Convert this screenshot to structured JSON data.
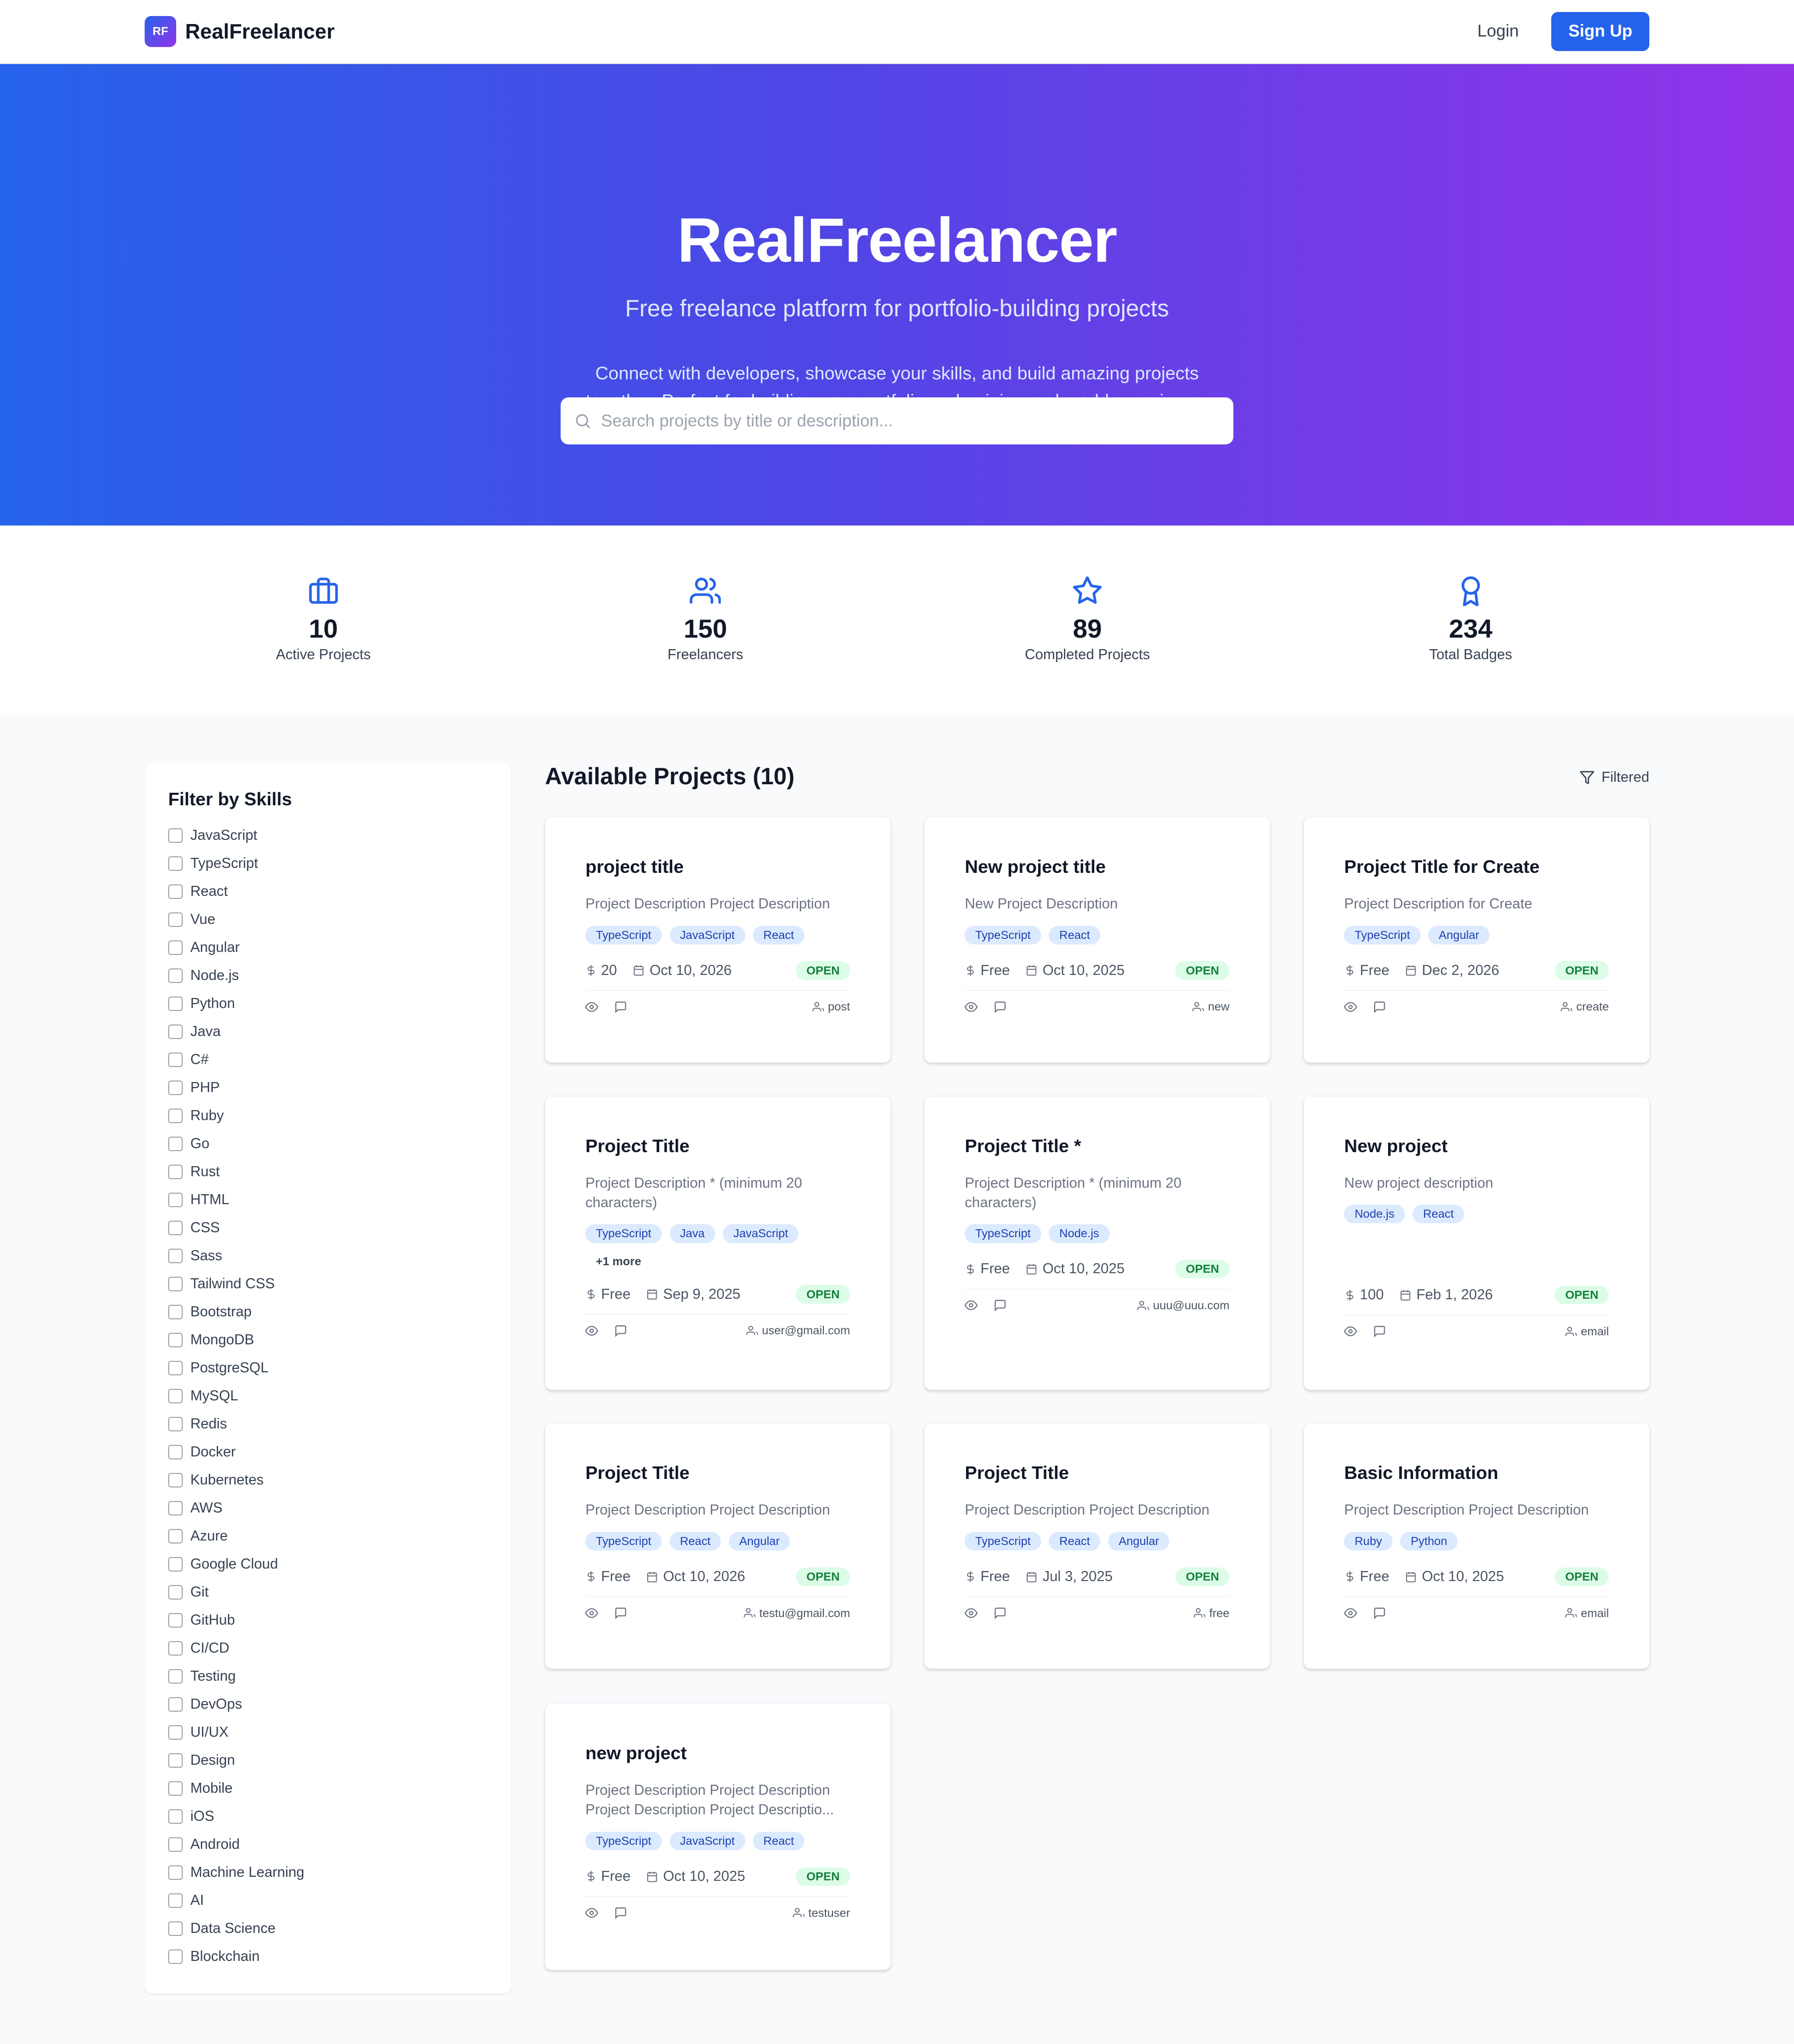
{
  "header": {
    "logo_mark": "RF",
    "brand": "RealFreelancer",
    "login": "Login",
    "signup": "Sign Up"
  },
  "hero": {
    "title": "RealFreelancer",
    "tagline": "Free freelance platform for portfolio-building projects",
    "description": "Connect with developers, showcase your skills, and build amazing projects together. Perfect for building your portfolio and gaining real-world experience.",
    "search_placeholder": "Search projects by title or description..."
  },
  "stats": [
    {
      "value": "10",
      "label": "Active Projects",
      "icon": "briefcase-icon"
    },
    {
      "value": "150",
      "label": "Freelancers",
      "icon": "users-icon"
    },
    {
      "value": "89",
      "label": "Completed Projects",
      "icon": "star-icon"
    },
    {
      "value": "234",
      "label": "Total Badges",
      "icon": "award-icon"
    }
  ],
  "sidebar": {
    "title": "Filter by Skills",
    "skills": [
      "JavaScript",
      "TypeScript",
      "React",
      "Vue",
      "Angular",
      "Node.js",
      "Python",
      "Java",
      "C#",
      "PHP",
      "Ruby",
      "Go",
      "Rust",
      "HTML",
      "CSS",
      "Sass",
      "Tailwind CSS",
      "Bootstrap",
      "MongoDB",
      "PostgreSQL",
      "MySQL",
      "Redis",
      "Docker",
      "Kubernetes",
      "AWS",
      "Azure",
      "Google Cloud",
      "Git",
      "GitHub",
      "CI/CD",
      "Testing",
      "DevOps",
      "UI/UX",
      "Design",
      "Mobile",
      "iOS",
      "Android",
      "Machine Learning",
      "AI",
      "Data Science",
      "Blockchain"
    ]
  },
  "projects_heading": "Available Projects (10)",
  "filtered_label": "Filtered",
  "projects": [
    {
      "title": "project title",
      "description": "Project Description Project Description",
      "tags": [
        "TypeScript",
        "JavaScript",
        "React"
      ],
      "more": "",
      "price": "20",
      "date": "Oct 10, 2026",
      "status": "OPEN",
      "owner": "post"
    },
    {
      "title": "New project title",
      "description": "New Project Description",
      "tags": [
        "TypeScript",
        "React"
      ],
      "more": "",
      "price": "Free",
      "date": "Oct 10, 2025",
      "status": "OPEN",
      "owner": "new"
    },
    {
      "title": "Project Title for Create",
      "description": "Project Description for Create",
      "tags": [
        "TypeScript",
        "Angular"
      ],
      "more": "",
      "price": "Free",
      "date": "Dec 2, 2026",
      "status": "OPEN",
      "owner": "create"
    },
    {
      "title": "Project Title",
      "description": "Project Description * (minimum 20 characters)",
      "tags": [
        "TypeScript",
        "Java",
        "JavaScript"
      ],
      "more": "+1 more",
      "price": "Free",
      "date": "Sep 9, 2025",
      "status": "OPEN",
      "owner": "user@gmail.com"
    },
    {
      "title": "Project Title *",
      "description": "Project Description * (minimum 20 characters)",
      "tags": [
        "TypeScript",
        "Node.js"
      ],
      "more": "",
      "price": "Free",
      "date": "Oct 10, 2025",
      "status": "OPEN",
      "owner": "uuu@uuu.com"
    },
    {
      "title": "New project",
      "description": "New project description",
      "tags": [
        "Node.js",
        "React"
      ],
      "more": "",
      "price": "100",
      "date": "Feb 1, 2026",
      "status": "OPEN",
      "owner": "email"
    },
    {
      "title": "Project Title",
      "description": "Project Description Project Description",
      "tags": [
        "TypeScript",
        "React",
        "Angular"
      ],
      "more": "",
      "price": "Free",
      "date": "Oct 10, 2026",
      "status": "OPEN",
      "owner": "testu@gmail.com"
    },
    {
      "title": "Project Title",
      "description": "Project Description Project Description",
      "tags": [
        "TypeScript",
        "React",
        "Angular"
      ],
      "more": "",
      "price": "Free",
      "date": "Jul 3, 2025",
      "status": "OPEN",
      "owner": "free"
    },
    {
      "title": "Basic Information",
      "description": "Project Description Project Description",
      "tags": [
        "Ruby",
        "Python"
      ],
      "more": "",
      "price": "Free",
      "date": "Oct 10, 2025",
      "status": "OPEN",
      "owner": "email"
    },
    {
      "title": "new project",
      "description": "Project Description Project Description Project Description Project Descriptio...",
      "tags": [
        "TypeScript",
        "JavaScript",
        "React"
      ],
      "more": "",
      "price": "Free",
      "date": "Oct 10, 2025",
      "status": "OPEN",
      "owner": "testuser"
    }
  ],
  "colors": {
    "primary": "#2563eb",
    "gradient_start": "#2563eb",
    "gradient_end": "#9333ea",
    "open_badge": "#dcfce7",
    "chip": "#dbeafe"
  }
}
